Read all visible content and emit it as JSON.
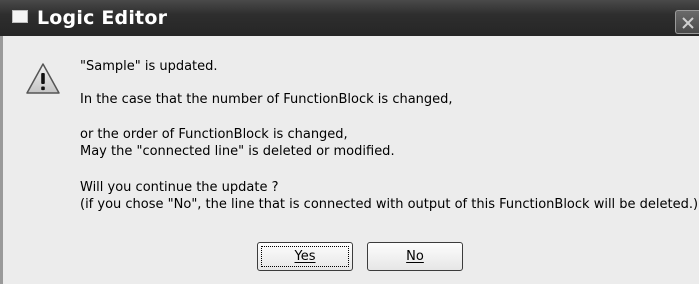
{
  "window": {
    "title": "Logic Editor"
  },
  "icons": {
    "title": "window-icon",
    "close": "close-icon",
    "message": "warning-icon"
  },
  "message": {
    "line1": "\"Sample\" is updated.",
    "line2": "In the case that the number of FunctionBlock is changed,",
    "line3": "or the order of FunctionBlock is changed,",
    "line4": "May the \"connected line\" is deleted or modified.",
    "line5": "Will you continue the update ?",
    "line6": "(if you chose \"No\", the line that is connected with output of this FunctionBlock will be deleted.)"
  },
  "buttons": {
    "yes_label": "Yes",
    "no_label": "No"
  },
  "colors": {
    "titlebar": "#2e2e2e",
    "dialog_bg": "#ececec",
    "text": "#000000"
  }
}
